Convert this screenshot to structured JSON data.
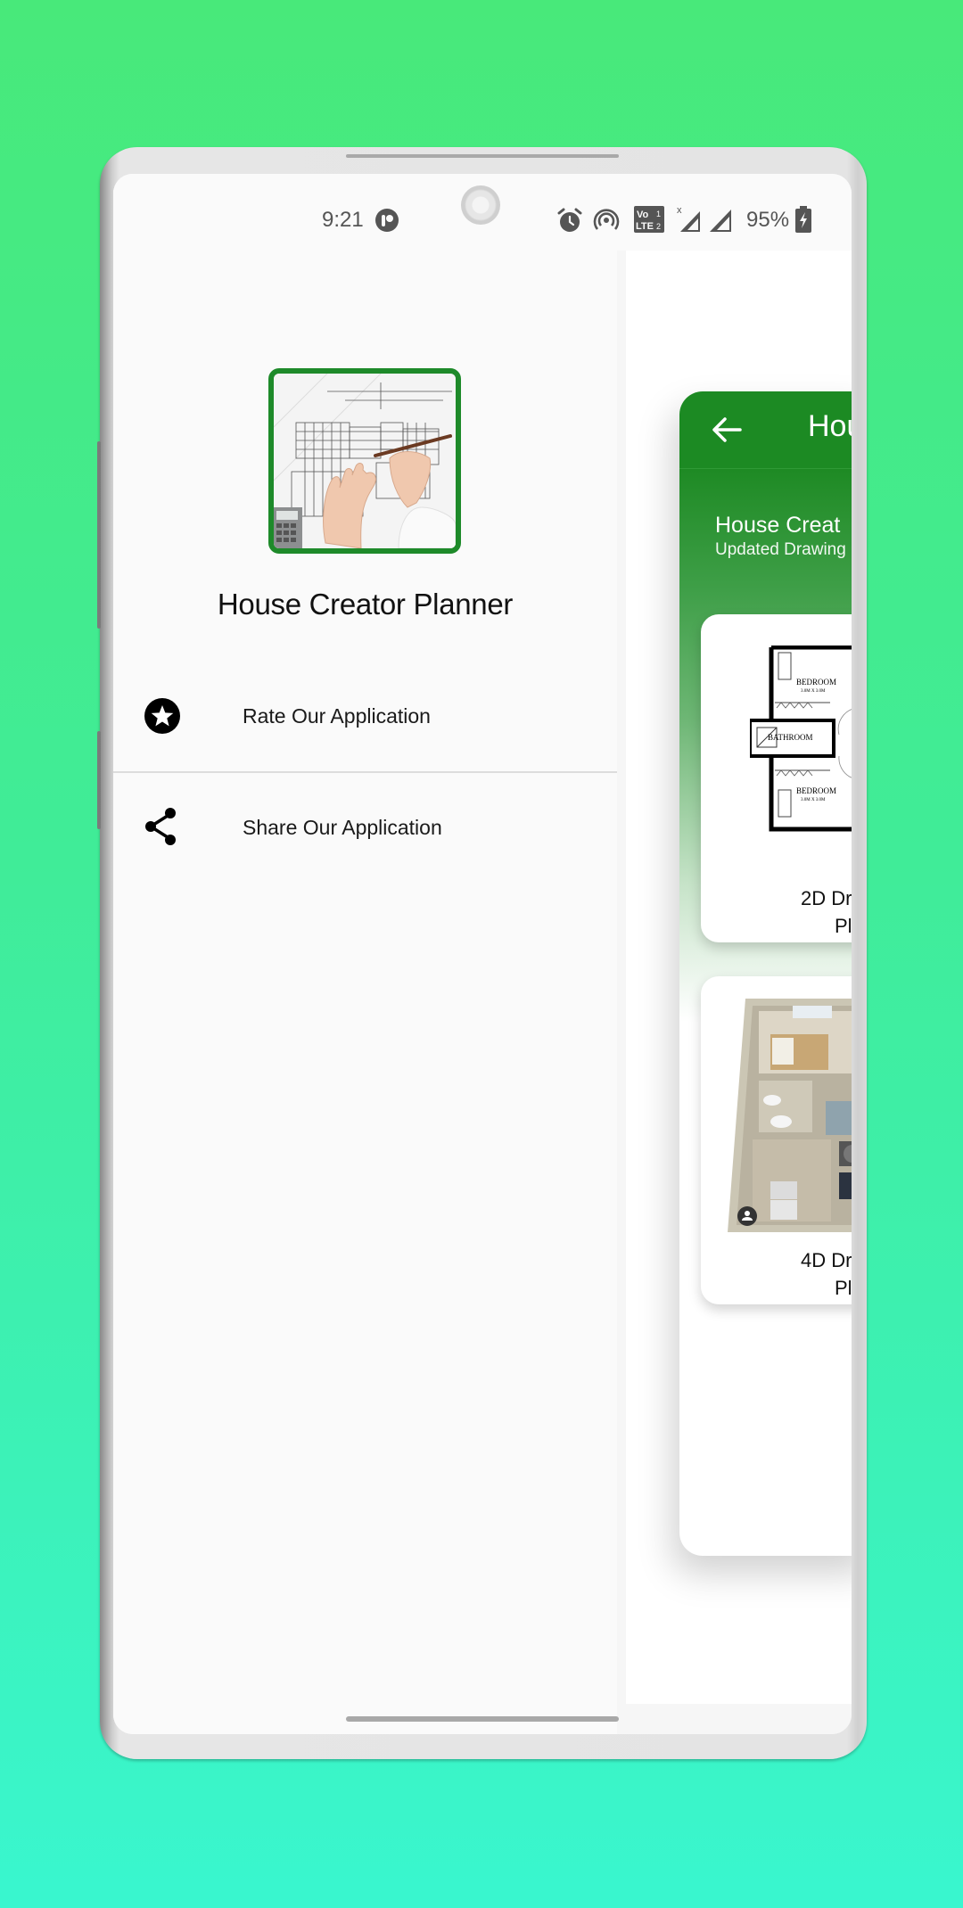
{
  "status_bar": {
    "time": "9:21",
    "notification_icon": "app-notification-icon",
    "icons": [
      "alarm-icon",
      "hotspot-icon",
      "volte-lte-icon",
      "signal-no-data-icon",
      "signal-icon",
      "battery-charging-icon"
    ],
    "volte_label_top": "Vo",
    "volte_label_bottom": "LTE",
    "battery_percent": "95%"
  },
  "drawer": {
    "header_image": "blueprint-drawing-image",
    "app_name": "House Creator Planner",
    "items": [
      {
        "icon": "star-circle-icon",
        "label": "Rate Our Application"
      },
      {
        "icon": "share-icon",
        "label": "Share Our Application"
      }
    ]
  },
  "main_app": {
    "toolbar_title": "Hou",
    "back_icon": "arrow-back-icon",
    "hero_title": "House Creat",
    "hero_subtitle": "Updated Drawing",
    "cards": [
      {
        "image": "2d-floor-plan-image",
        "line1": "2D Dr",
        "line2": "Pla",
        "room_labels": [
          "BEDROOM",
          "3.0M X 3.0M",
          "BATHROOM",
          "BEDROOM",
          "3.0M X 3.0M"
        ]
      },
      {
        "image": "3d-floor-plan-image",
        "line1": "4D Dr",
        "line2": "Pla"
      }
    ]
  },
  "colors": {
    "accent_green": "#1C8A23",
    "drawer_background": "#FAFAFA",
    "background_top": "#48E97A",
    "background_bottom": "#39F6CF"
  }
}
